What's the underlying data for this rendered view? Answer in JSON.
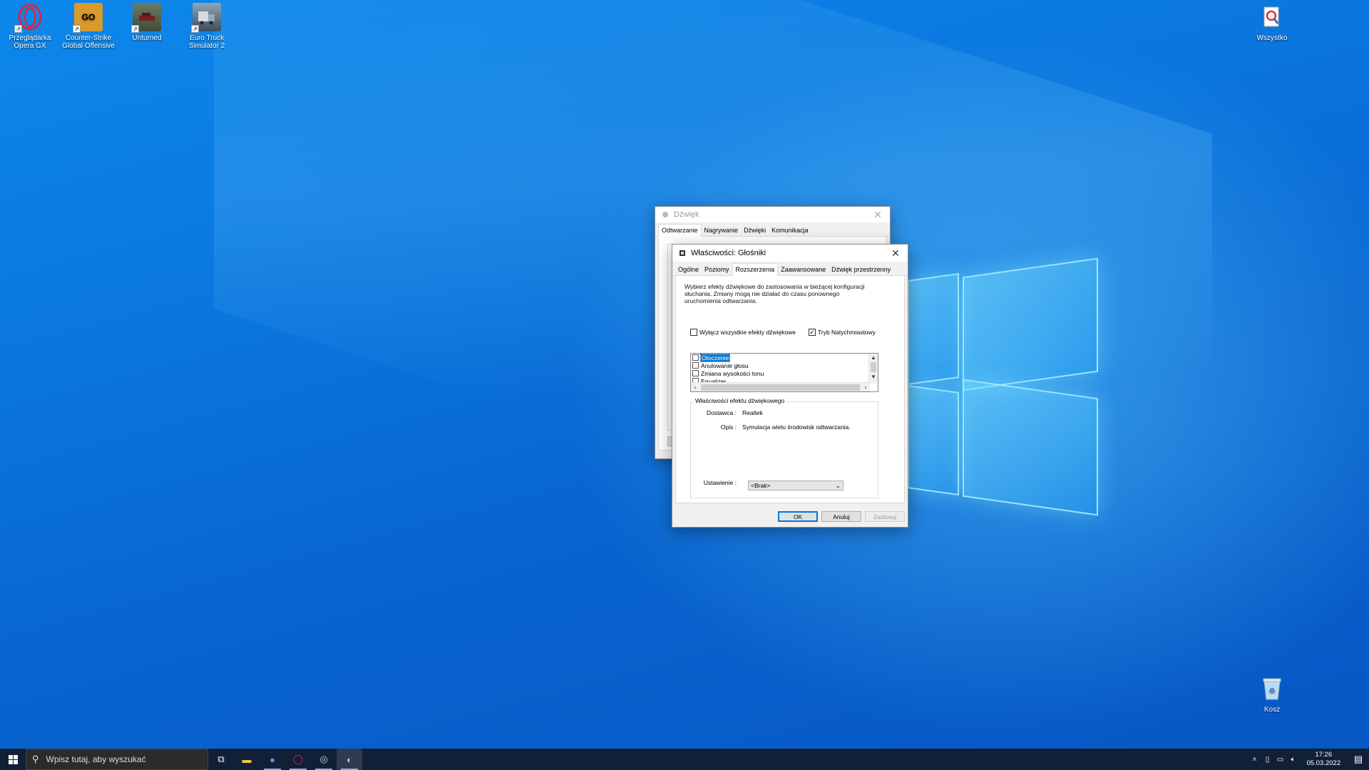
{
  "desktop": {
    "icons": [
      {
        "label": "Przeglądarka Opera GX",
        "icon": "opera-gx-icon"
      },
      {
        "label": "Counter-Strike Global Offensive",
        "icon": "csgo-icon"
      },
      {
        "label": "Unturned",
        "icon": "unturned-icon"
      },
      {
        "label": "Euro Truck Simulator 2",
        "icon": "ets2-icon"
      },
      {
        "label": "Wszystko",
        "icon": "everything-search-icon"
      },
      {
        "label": "Kosz",
        "icon": "recycle-bin-icon"
      }
    ],
    "csgo_badge": "GO"
  },
  "sound_window": {
    "title": "Dźwięk",
    "tabs": [
      "Odtwarzanie",
      "Nagrywanie",
      "Dźwięki",
      "Komunikacja"
    ],
    "active_tab": "Odtwarzanie"
  },
  "props_window": {
    "title": "Właściwości: Głośniki",
    "tabs": [
      "Ogólne",
      "Poziomy",
      "Rozszerzenia",
      "Zaawansowane",
      "Dźwięk przestrzenny"
    ],
    "active_tab": "Rozszerzenia",
    "description": "Wybierz efekty dźwiękowe do zastosowania w bieżącej konfiguracji słuchania. Zmiany mogą nie działać do czasu ponownego uruchomienia odtwarzania.",
    "disable_all_label": "Wyłącz wszystkie efekty dźwiękowe",
    "disable_all_checked": false,
    "instant_mode_label": "Tryb Natychmiastowy",
    "instant_mode_checked": true,
    "effects": [
      {
        "label": "Otoczenie",
        "checked": false,
        "selected": true
      },
      {
        "label": "Anulowanie głosu",
        "checked": false,
        "selected": false
      },
      {
        "label": "Zmiana wysokości tonu",
        "checked": false,
        "selected": false
      },
      {
        "label": "Equalizer",
        "checked": false,
        "selected": false
      }
    ],
    "group_title": "Właściwości efektu dźwiękowego",
    "provider_key": "Dostawca :",
    "provider_value": "Realtek",
    "desc_key": "Opis :",
    "desc_value": "Symulacja wielu środowisk odtwarzania.",
    "setting_key": "Ustawienie :",
    "setting_value": "<Brak>",
    "buttons": {
      "ok": "OK",
      "cancel": "Anuluj",
      "apply": "Zastosuj"
    }
  },
  "taskbar": {
    "search_placeholder": "Wpisz tutaj, aby wyszukać",
    "apps": [
      "task-view-icon",
      "file-explorer-icon",
      "discord-icon",
      "opera-gx-icon",
      "steam-icon",
      "sound-settings-icon"
    ],
    "time": "17:26",
    "date": "05.03.2022"
  },
  "colors": {
    "accent": "#0078d7",
    "taskbar": "#121c2e",
    "opera_red": "#e0243f"
  }
}
